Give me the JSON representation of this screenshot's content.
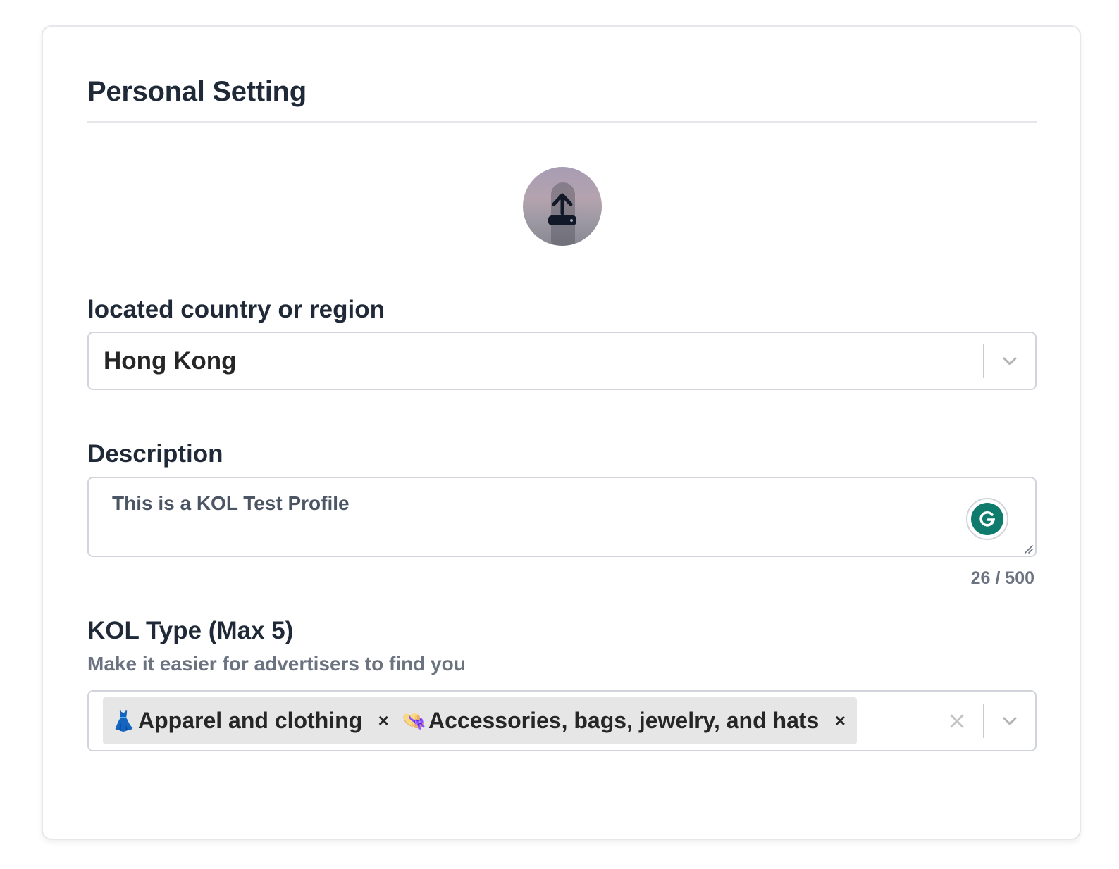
{
  "page": {
    "title": "Personal Setting"
  },
  "avatar": {
    "icon": "upload-icon"
  },
  "location": {
    "label": "located country or region",
    "selected": "Hong Kong"
  },
  "description": {
    "label": "Description",
    "value": "This is a KOL Test Profile",
    "counter": "26 / 500",
    "assistant_icon": "grammarly-icon"
  },
  "kol_type": {
    "label": "KOL Type (Max 5)",
    "hint": "Make it easier for advertisers to find you",
    "chips": [
      {
        "emoji": "👗",
        "label": "Apparel and clothing",
        "remove": "×"
      },
      {
        "emoji": "👒",
        "label": "Accessories, bags, jewelry, and hats",
        "remove": "×"
      }
    ]
  },
  "colors": {
    "text_primary": "#1f2937",
    "text_muted": "#6b7280",
    "border": "#d1d5db",
    "chip_bg": "#e6e6e6",
    "grammarly": "#0f7b6c"
  }
}
